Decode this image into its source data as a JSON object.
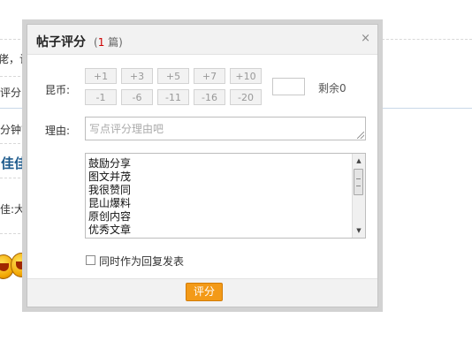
{
  "background": {
    "fragments": [
      "佬，让",
      "评分",
      "分钟前",
      "佳佳",
      "佳:大"
    ]
  },
  "dialog": {
    "title": "帖子评分",
    "count_prefix": "(",
    "count_value": "1",
    "count_suffix": " 篇)",
    "close_label": "×",
    "currency_label": "昆币:",
    "score_buttons_row1": [
      "+1",
      "+3",
      "+5",
      "+7",
      "+10"
    ],
    "score_buttons_row2": [
      "-1",
      "-6",
      "-11",
      "-16",
      "-20"
    ],
    "score_input_value": "",
    "remaining_label": "剩余0",
    "reason_label": "理由:",
    "reason_placeholder": "写点评分理由吧",
    "reason_options": [
      "鼓励分享",
      "图文并茂",
      "我很赞同",
      "昆山爆料",
      "原创内容",
      "优秀文章"
    ],
    "reply_checkbox_label": "同时作为回复发表",
    "reply_checked": false,
    "submit_label": "评分"
  },
  "colors": {
    "accent": "#f39a18",
    "count_number": "#cc0000",
    "link_blue": "#1d5a8c"
  }
}
